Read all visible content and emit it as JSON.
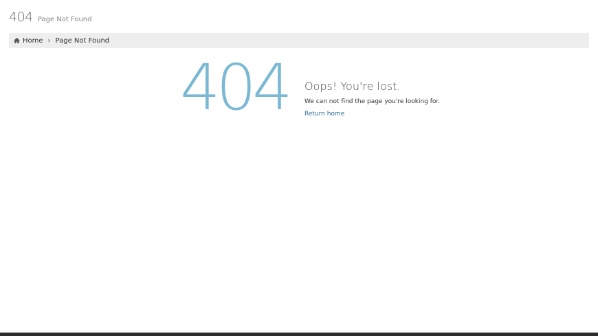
{
  "header": {
    "code": "404",
    "subtitle": "Page Not Found"
  },
  "breadcrumb": {
    "home_label": "Home",
    "current_label": "Page Not Found",
    "home_icon": "home-icon",
    "separator_icon": "chevron-right-icon"
  },
  "error": {
    "code": "404",
    "title": "Oops! You're lost.",
    "message": "We can not find the page you're looking for.",
    "link_label": "Return home"
  },
  "colors": {
    "accent": "#7bb8d4",
    "link": "#2a6e96",
    "breadcrumb_bg": "#eeeeee",
    "footer": "#2d2d2d"
  }
}
